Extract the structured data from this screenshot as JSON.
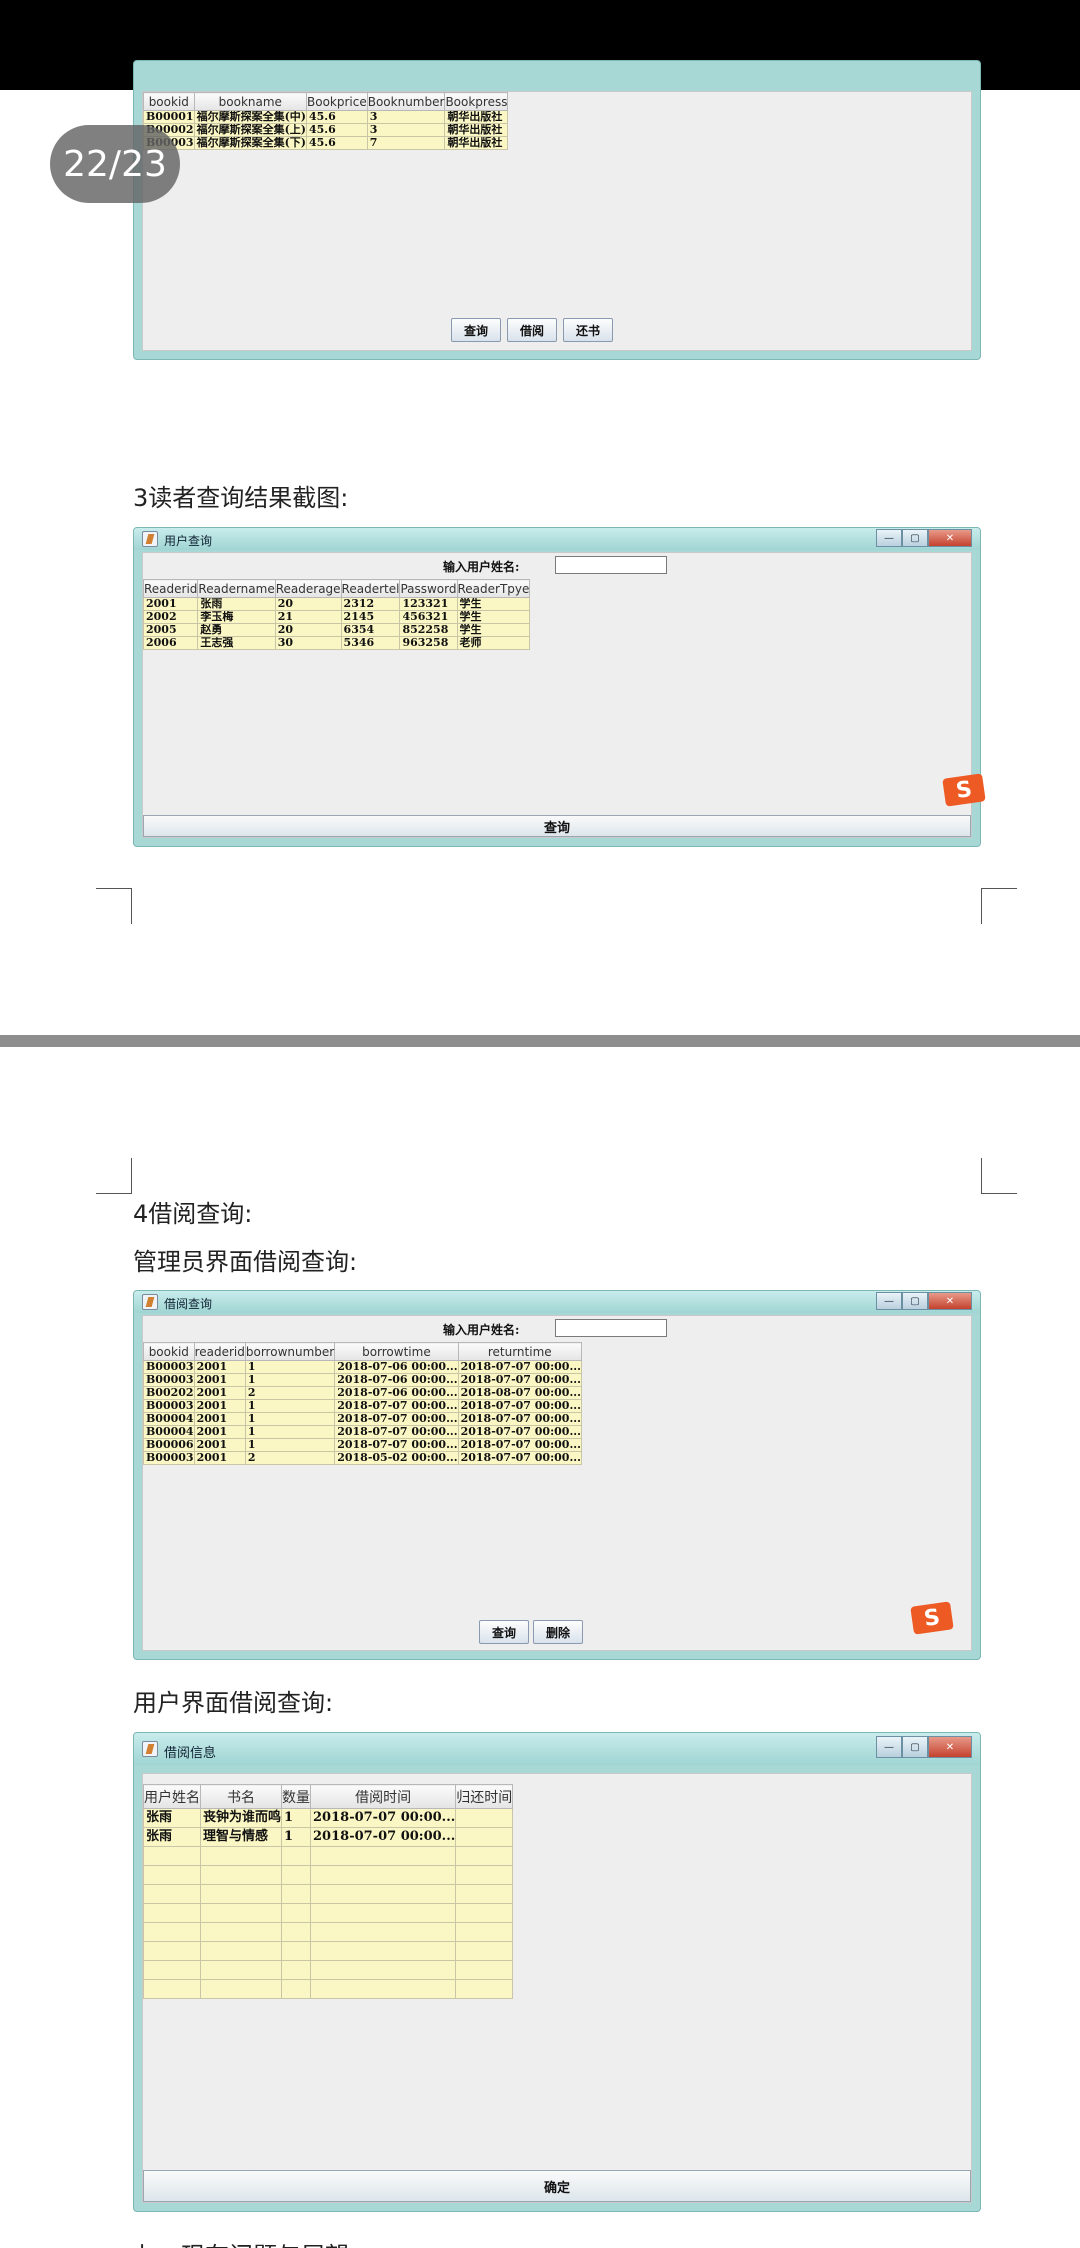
{
  "page_counter": "22/23",
  "headings": {
    "reader_query": "3读者查询结果截图:",
    "borrow_query": "4借阅查询:",
    "admin_borrow": "管理员界面借阅查询:",
    "user_borrow": "用户界面借阅查询:",
    "next_section": "七、现存问题与展望:"
  },
  "book_window": {
    "columns": [
      "bookid",
      "bookname",
      "Bookprice",
      "Booknumber",
      "Bookpress"
    ],
    "rows": [
      [
        "B00001",
        "福尔摩斯探案全集(中)",
        "45.6",
        "3",
        "朝华出版社"
      ],
      [
        "B00002",
        "福尔摩斯探案全集(上)",
        "45.6",
        "3",
        "朝华出版社"
      ],
      [
        "B00003",
        "福尔摩斯探案全集(下)",
        "45.6",
        "7",
        "朝华出版社"
      ]
    ],
    "buttons": [
      "查询",
      "借阅",
      "还书"
    ]
  },
  "reader_window": {
    "title": "用户查询",
    "search_label": "输入用户姓名:",
    "columns": [
      "Readerid",
      "Readername",
      "Readerage",
      "Readertel",
      "Password",
      "ReaderTpye"
    ],
    "rows": [
      [
        "2001",
        "张雨",
        "20",
        "2312",
        "123321",
        "学生"
      ],
      [
        "2002",
        "李玉梅",
        "21",
        "2145",
        "456321",
        "学生"
      ],
      [
        "2005",
        "赵勇",
        "20",
        "6354",
        "852258",
        "学生"
      ],
      [
        "2006",
        "王志强",
        "30",
        "5346",
        "963258",
        "老师"
      ]
    ],
    "button": "查询",
    "sogou_icon": "S"
  },
  "admin_window": {
    "title": "借阅查询",
    "search_label": "输入用户姓名:",
    "columns": [
      "bookid",
      "readerid",
      "borrownumber",
      "borrowtime",
      "returntime"
    ],
    "rows": [
      [
        "B00003",
        "2001",
        "1",
        "2018-07-06 00:00...",
        "2018-07-07 00:00..."
      ],
      [
        "B00003",
        "2001",
        "1",
        "2018-07-06 00:00...",
        "2018-07-07 00:00..."
      ],
      [
        "B00202",
        "2001",
        "2",
        "2018-07-06 00:00...",
        "2018-08-07 00:00..."
      ],
      [
        "B00003",
        "2001",
        "1",
        "2018-07-07 00:00...",
        "2018-07-07 00:00..."
      ],
      [
        "B00004",
        "2001",
        "1",
        "2018-07-07 00:00...",
        "2018-07-07 00:00..."
      ],
      [
        "B00004",
        "2001",
        "1",
        "2018-07-07 00:00...",
        "2018-07-07 00:00..."
      ],
      [
        "B00006",
        "2001",
        "1",
        "2018-07-07 00:00...",
        "2018-07-07 00:00..."
      ],
      [
        "B00003",
        "2001",
        "2",
        "2018-05-02 00:00...",
        "2018-07-07 00:00..."
      ]
    ],
    "buttons": [
      "查询",
      "删除"
    ],
    "sogou_icon": "S"
  },
  "user_window": {
    "title": "借阅信息",
    "columns": [
      "用户姓名",
      "书名",
      "数量",
      "借阅时间",
      "归还时间"
    ],
    "rows": [
      [
        "张雨",
        "丧钟为谁而鸣",
        "1",
        "2018-07-07 00:00...",
        ""
      ],
      [
        "张雨",
        "理智与情感",
        "1",
        "2018-07-07 00:00...",
        ""
      ],
      [
        "",
        "",
        "",
        "",
        ""
      ],
      [
        "",
        "",
        "",
        "",
        ""
      ],
      [
        "",
        "",
        "",
        "",
        ""
      ],
      [
        "",
        "",
        "",
        "",
        ""
      ],
      [
        "",
        "",
        "",
        "",
        ""
      ],
      [
        "",
        "",
        "",
        "",
        ""
      ],
      [
        "",
        "",
        "",
        "",
        ""
      ],
      [
        "",
        "",
        "",
        "",
        ""
      ]
    ],
    "button": "确定"
  },
  "window_controls": {
    "minimize": "—",
    "maximize": "▢",
    "close": "✕"
  }
}
